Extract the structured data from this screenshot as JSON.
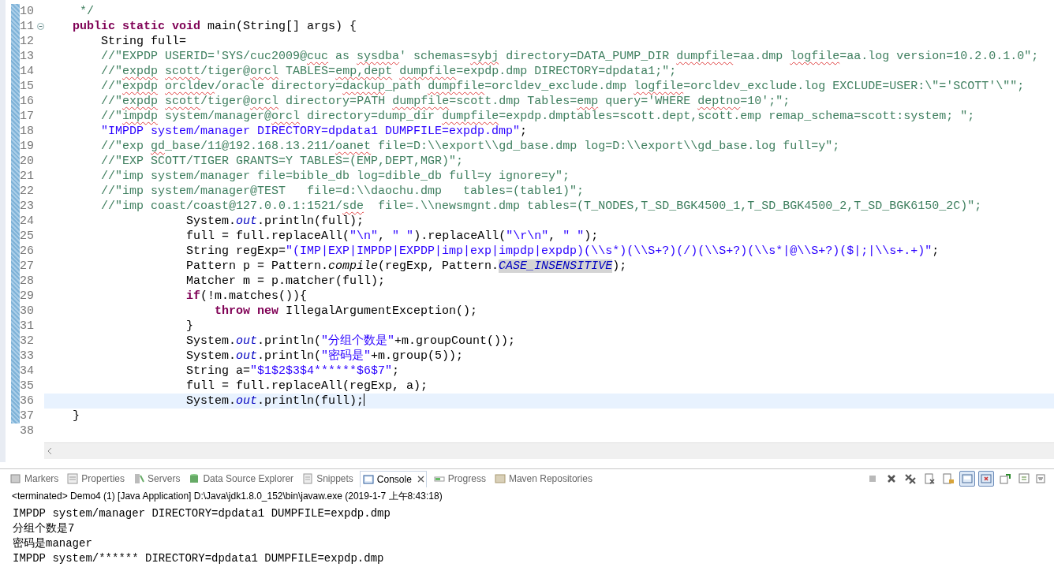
{
  "editor": {
    "lines": [
      {
        "n": "10",
        "tokens": [
          {
            "t": "     */",
            "kind": "comment"
          }
        ]
      },
      {
        "n": "11",
        "fold": true,
        "tokens": [
          {
            "t": "    public static void",
            "kind": "kw"
          },
          {
            "t": " main(String[] args) {",
            "kind": "plain"
          }
        ]
      },
      {
        "n": "12",
        "tokens": [
          {
            "t": "        String full=",
            "kind": "plain"
          }
        ]
      },
      {
        "n": "13",
        "tokens": [
          {
            "t": "        //\"EXPDP USERID='SYS/cuc2009@",
            "kind": "comment"
          },
          {
            "t": "cuc",
            "kind": "typo"
          },
          {
            "t": " as ",
            "kind": "comment"
          },
          {
            "t": "sysdba",
            "kind": "typo"
          },
          {
            "t": "' schemas=",
            "kind": "comment"
          },
          {
            "t": "sybj",
            "kind": "typo"
          },
          {
            "t": " directory=DATA_PUMP_DIR ",
            "kind": "comment"
          },
          {
            "t": "dumpfile",
            "kind": "typo"
          },
          {
            "t": "=aa.dmp ",
            "kind": "comment"
          },
          {
            "t": "logfile",
            "kind": "typo"
          },
          {
            "t": "=aa.log version=10.2.0.1.0\";",
            "kind": "comment"
          }
        ]
      },
      {
        "n": "14",
        "tokens": [
          {
            "t": "        //\"",
            "kind": "comment"
          },
          {
            "t": "expdp ",
            "kind": "typo"
          },
          {
            "t": "scott",
            "kind": "typo"
          },
          {
            "t": "/tiger@",
            "kind": "comment"
          },
          {
            "t": "orcl",
            "kind": "typo"
          },
          {
            "t": " TABLES=",
            "kind": "comment"
          },
          {
            "t": "emp,dept ",
            "kind": "typo"
          },
          {
            "t": "dumpfile",
            "kind": "typo"
          },
          {
            "t": "=expdp.dmp DIRECTORY=dpdata1;\";",
            "kind": "comment"
          }
        ]
      },
      {
        "n": "15",
        "tokens": [
          {
            "t": "        //\"",
            "kind": "comment"
          },
          {
            "t": "expdp ",
            "kind": "typo"
          },
          {
            "t": "orcldev",
            "kind": "typo"
          },
          {
            "t": "/oracle directory=",
            "kind": "comment"
          },
          {
            "t": "dackup",
            "kind": "typo"
          },
          {
            "t": "_path ",
            "kind": "comment"
          },
          {
            "t": "dumpfile",
            "kind": "typo"
          },
          {
            "t": "=orcldev_exclude.dmp ",
            "kind": "comment"
          },
          {
            "t": "logfile",
            "kind": "typo"
          },
          {
            "t": "=orcldev_exclude.log EXCLUDE=USER:\\\"='SCOTT'\\\"\";",
            "kind": "comment"
          }
        ]
      },
      {
        "n": "16",
        "tokens": [
          {
            "t": "        //\"",
            "kind": "comment"
          },
          {
            "t": "expdp ",
            "kind": "typo"
          },
          {
            "t": "scott",
            "kind": "typo"
          },
          {
            "t": "/tiger@",
            "kind": "comment"
          },
          {
            "t": "orcl",
            "kind": "typo"
          },
          {
            "t": " directory=PATH ",
            "kind": "comment"
          },
          {
            "t": "dumpfile",
            "kind": "typo"
          },
          {
            "t": "=scott.dmp Tables=",
            "kind": "comment"
          },
          {
            "t": "emp",
            "kind": "typo"
          },
          {
            "t": " query='WHERE ",
            "kind": "comment"
          },
          {
            "t": "deptno",
            "kind": "typo"
          },
          {
            "t": "=10';\";",
            "kind": "comment"
          }
        ]
      },
      {
        "n": "17",
        "tokens": [
          {
            "t": "        //\"",
            "kind": "comment"
          },
          {
            "t": "impdp",
            "kind": "typo"
          },
          {
            "t": " system/manager@",
            "kind": "comment"
          },
          {
            "t": "orcl",
            "kind": "typo"
          },
          {
            "t": " directory=dump_dir ",
            "kind": "comment"
          },
          {
            "t": "dumpfile",
            "kind": "typo"
          },
          {
            "t": "=expdp.dmptables=scott.dept,scott.emp remap_schema=scott:system; \";",
            "kind": "comment"
          }
        ]
      },
      {
        "n": "18",
        "tokens": [
          {
            "t": "        \"IMPDP system/manager DIRECTORY=dpdata1 DUMPFILE=expdp.dmp\"",
            "kind": "str"
          },
          {
            "t": ";",
            "kind": "plain"
          }
        ]
      },
      {
        "n": "19",
        "tokens": [
          {
            "t": "        //\"exp ",
            "kind": "comment"
          },
          {
            "t": "gd",
            "kind": "typo"
          },
          {
            "t": "_base/11@192.168.13.211/",
            "kind": "comment"
          },
          {
            "t": "oanet",
            "kind": "typo"
          },
          {
            "t": " file=D:\\\\export\\\\gd_base.dmp log=D:\\\\export\\\\gd_base.log full=y\";",
            "kind": "comment"
          }
        ]
      },
      {
        "n": "20",
        "tokens": [
          {
            "t": "        //\"EXP SCOTT/TIGER GRANTS=Y TABLES=(EMP,DEPT,MGR)\";",
            "kind": "comment"
          }
        ]
      },
      {
        "n": "21",
        "tokens": [
          {
            "t": "        //\"imp system/manager file=bible_db log=dible_db full=y ignore=y\";",
            "kind": "comment"
          }
        ]
      },
      {
        "n": "22",
        "tokens": [
          {
            "t": "        //\"imp system/manager@TEST   file=d:\\\\daochu.dmp   tables=(table1)\";",
            "kind": "comment"
          }
        ]
      },
      {
        "n": "23",
        "tokens": [
          {
            "t": "        //\"imp coast/coast@127.0.0.1:1521/",
            "kind": "comment"
          },
          {
            "t": "sde",
            "kind": "typo"
          },
          {
            "t": "  file=.\\\\newsmgnt.dmp tables=(T_NODES,T_SD_BGK4500_1,T_SD_BGK4500_2,T_SD_BGK6150_2C)\";",
            "kind": "comment"
          }
        ]
      },
      {
        "n": "24",
        "tokens": [
          {
            "t": "                    System.",
            "kind": "plain"
          },
          {
            "t": "out",
            "kind": "static"
          },
          {
            "t": ".println(full);",
            "kind": "plain"
          }
        ]
      },
      {
        "n": "25",
        "tokens": [
          {
            "t": "                    full = full.replaceAll(",
            "kind": "plain"
          },
          {
            "t": "\"\\n\"",
            "kind": "str"
          },
          {
            "t": ", ",
            "kind": "plain"
          },
          {
            "t": "\" \"",
            "kind": "str"
          },
          {
            "t": ").replaceAll(",
            "kind": "plain"
          },
          {
            "t": "\"\\r\\n\"",
            "kind": "str"
          },
          {
            "t": ", ",
            "kind": "plain"
          },
          {
            "t": "\" \"",
            "kind": "str"
          },
          {
            "t": ");",
            "kind": "plain"
          }
        ]
      },
      {
        "n": "26",
        "tokens": [
          {
            "t": "                    String regExp=",
            "kind": "plain"
          },
          {
            "t": "\"(IMP|EXP|IMPDP|EXPDP|imp|exp|impdp|expdp)(\\\\s*)(\\\\S+?)(/)(\\\\S+?)(\\\\s*|@\\\\S+?)($|;|\\\\s+.+)\"",
            "kind": "str"
          },
          {
            "t": ";",
            "kind": "plain"
          }
        ]
      },
      {
        "n": "27",
        "tokens": [
          {
            "t": "                    Pattern p = Pattern.",
            "kind": "plain"
          },
          {
            "t": "compile",
            "kind": "italic"
          },
          {
            "t": "(regExp, Pattern.",
            "kind": "plain"
          },
          {
            "t": "CASE_INSENSITIVE",
            "kind": "mark"
          },
          {
            "t": ");",
            "kind": "plain"
          }
        ]
      },
      {
        "n": "28",
        "tokens": [
          {
            "t": "                    Matcher m = p.matcher(full);",
            "kind": "plain"
          }
        ]
      },
      {
        "n": "29",
        "tokens": [
          {
            "t": "                    if",
            "kind": "kw"
          },
          {
            "t": "(!m.matches()){",
            "kind": "plain"
          }
        ]
      },
      {
        "n": "30",
        "tokens": [
          {
            "t": "                        throw new",
            "kind": "kw"
          },
          {
            "t": " IllegalArgumentException();",
            "kind": "plain"
          }
        ]
      },
      {
        "n": "31",
        "tokens": [
          {
            "t": "                    }",
            "kind": "plain"
          }
        ]
      },
      {
        "n": "32",
        "tokens": [
          {
            "t": "                    System.",
            "kind": "plain"
          },
          {
            "t": "out",
            "kind": "static"
          },
          {
            "t": ".println(",
            "kind": "plain"
          },
          {
            "t": "\"分组个数是\"",
            "kind": "str"
          },
          {
            "t": "+m.groupCount());",
            "kind": "plain"
          }
        ]
      },
      {
        "n": "33",
        "tokens": [
          {
            "t": "                    System.",
            "kind": "plain"
          },
          {
            "t": "out",
            "kind": "static"
          },
          {
            "t": ".println(",
            "kind": "plain"
          },
          {
            "t": "\"密码是\"",
            "kind": "str"
          },
          {
            "t": "+m.group(5));",
            "kind": "plain"
          }
        ]
      },
      {
        "n": "34",
        "tokens": [
          {
            "t": "                    String a=",
            "kind": "plain"
          },
          {
            "t": "\"$1$2$3$4******$6$7\"",
            "kind": "str"
          },
          {
            "t": ";",
            "kind": "plain"
          }
        ]
      },
      {
        "n": "35",
        "tokens": [
          {
            "t": "                    full = full.replaceAll(regExp, a);",
            "kind": "plain"
          }
        ]
      },
      {
        "n": "36",
        "current": true,
        "tokens": [
          {
            "t": "                    System.",
            "kind": "plain"
          },
          {
            "t": "out",
            "kind": "static"
          },
          {
            "t": ".println(full);",
            "kind": "plain"
          }
        ]
      },
      {
        "n": "37",
        "tokens": [
          {
            "t": "    }",
            "kind": "plain"
          }
        ]
      },
      {
        "n": "38"
      }
    ]
  },
  "panel": {
    "tabs": [
      {
        "label": "Markers",
        "kind": "markers",
        "selected": false
      },
      {
        "label": "Properties",
        "kind": "properties",
        "selected": false
      },
      {
        "label": "Servers",
        "kind": "servers",
        "selected": false
      },
      {
        "label": "Data Source Explorer",
        "kind": "database",
        "selected": false
      },
      {
        "label": "Snippets",
        "kind": "snippets",
        "selected": false
      },
      {
        "label": "Console",
        "kind": "console",
        "selected": true
      },
      {
        "label": "Progress",
        "kind": "progress",
        "selected": false
      },
      {
        "label": "Maven Repositories",
        "kind": "maven",
        "selected": false
      }
    ],
    "toolbar": [
      {
        "kind": "stop",
        "pressed": false
      },
      {
        "kind": "remove",
        "pressed": false
      },
      {
        "kind": "remove-all",
        "pressed": false
      },
      {
        "kind": "clear",
        "pressed": false
      },
      {
        "kind": "scroll-lock",
        "pressed": false
      },
      {
        "kind": "show-out",
        "pressed": true
      },
      {
        "kind": "show-err",
        "pressed": true
      },
      {
        "kind": "pin",
        "pressed": false
      },
      {
        "kind": "new-console",
        "pressed": false
      }
    ],
    "status": "<terminated> Demo4 (1) [Java Application] D:\\Java\\jdk1.8.0_152\\bin\\javaw.exe (2019-1-7 上午8:43:18)",
    "output": [
      "IMPDP system/manager DIRECTORY=dpdata1 DUMPFILE=expdp.dmp",
      "分组个数是7",
      "密码是manager",
      "IMPDP system/****** DIRECTORY=dpdata1 DUMPFILE=expdp.dmp"
    ]
  }
}
